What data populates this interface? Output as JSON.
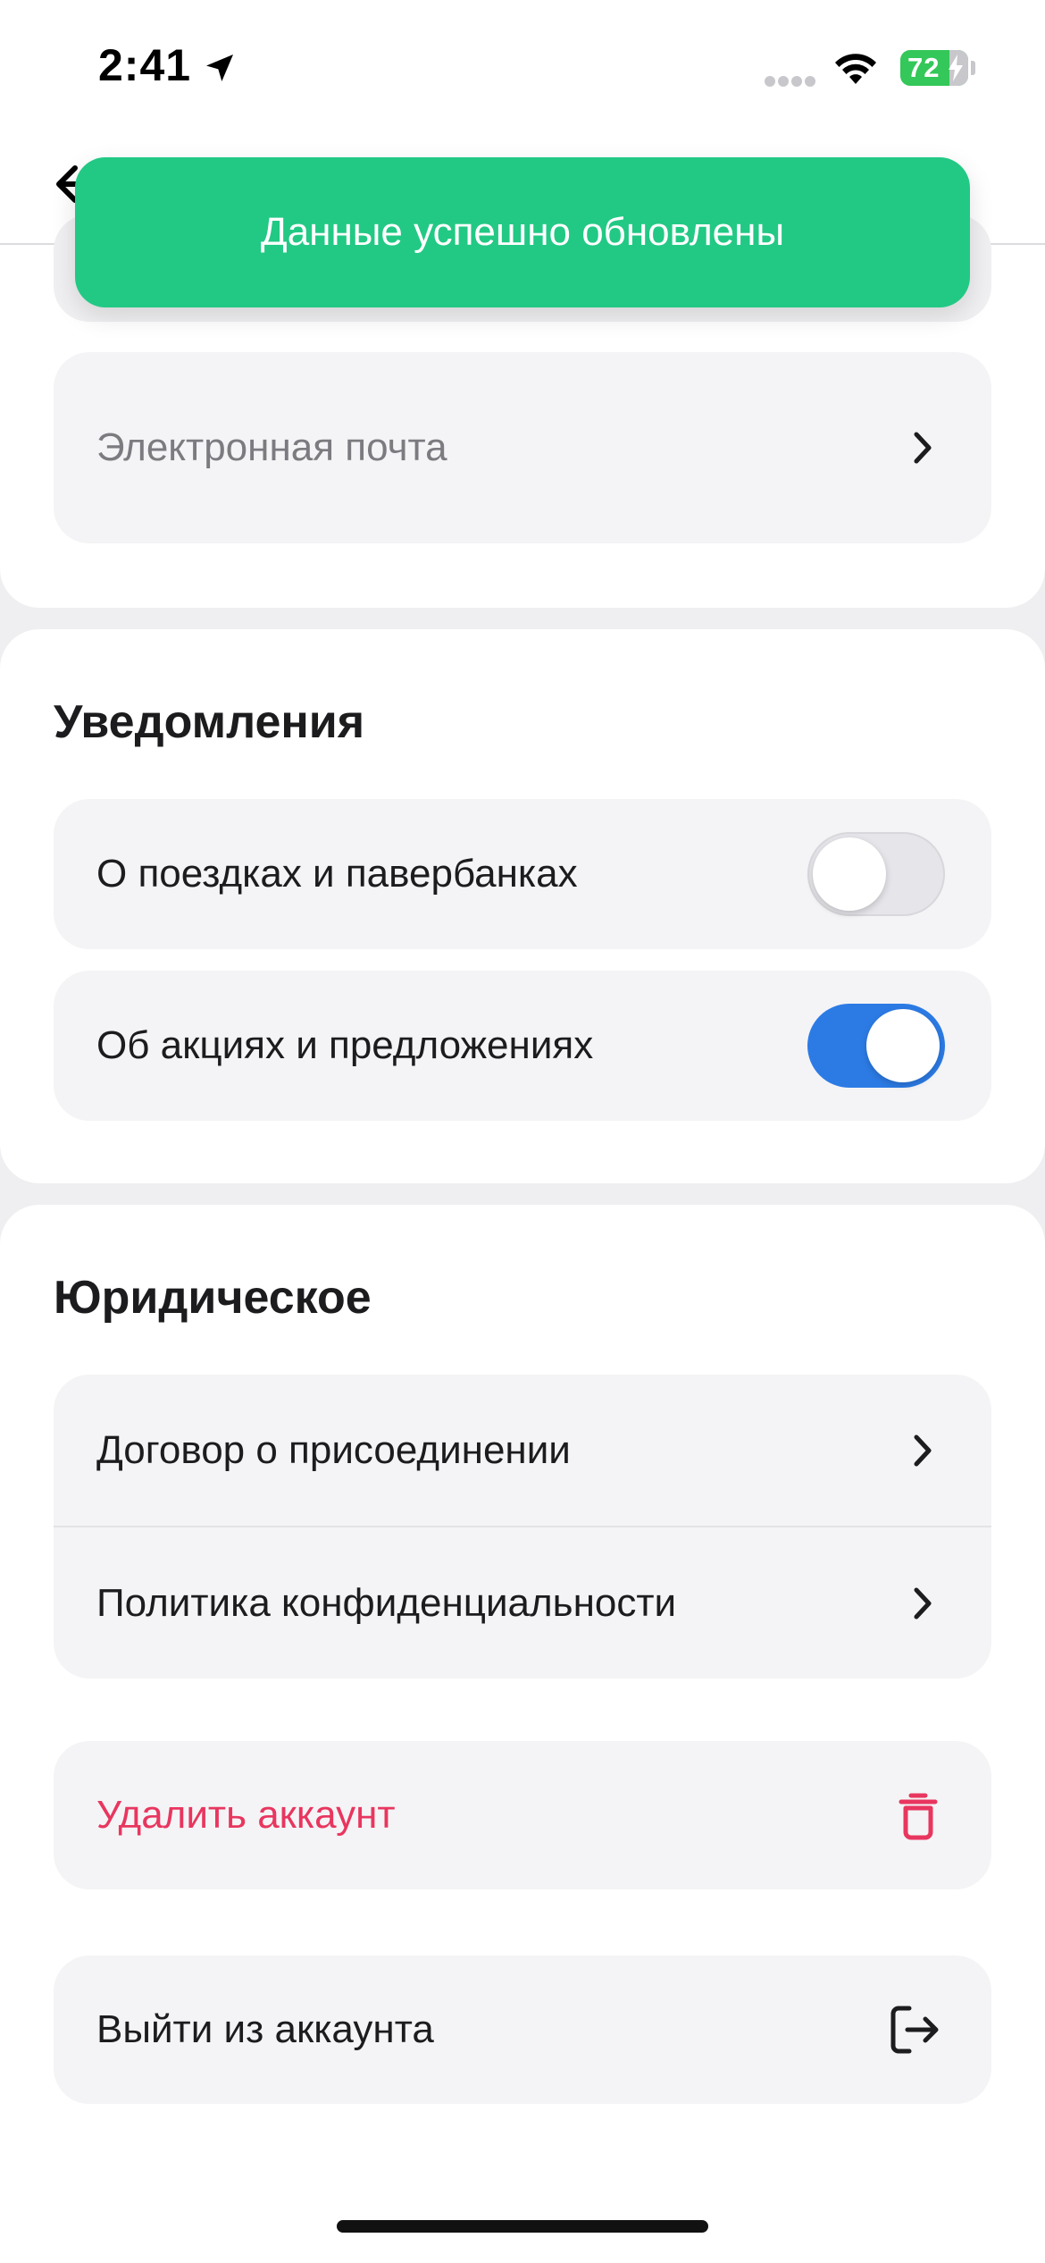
{
  "status_bar": {
    "time": "2:41",
    "battery_level": "72",
    "battery_fraction": 0.72
  },
  "toast": {
    "message": "Данные успешно обновлены",
    "color": "#22c984"
  },
  "profile": {
    "email_placeholder": "Электронная почта"
  },
  "notifications": {
    "title": "Уведомления",
    "items": [
      {
        "label": "О поездках и павербанках",
        "enabled": false
      },
      {
        "label": "Об акциях и предложениях",
        "enabled": true
      }
    ]
  },
  "legal": {
    "title": "Юридическое",
    "items": [
      {
        "label": "Договор о присоединении"
      },
      {
        "label": "Политика конфиденциальности"
      }
    ]
  },
  "account": {
    "delete_label": "Удалить аккаунт",
    "logout_label": "Выйти из аккаунта"
  },
  "colors": {
    "accent": "#2c7be5",
    "danger": "#e8365f",
    "success": "#22c984"
  },
  "icons": {
    "back": "arrow-left-icon",
    "chevron": "chevron-right-icon",
    "delete": "trash-icon",
    "logout": "logout-icon",
    "location": "location-arrow-icon",
    "wifi": "wifi-icon"
  }
}
